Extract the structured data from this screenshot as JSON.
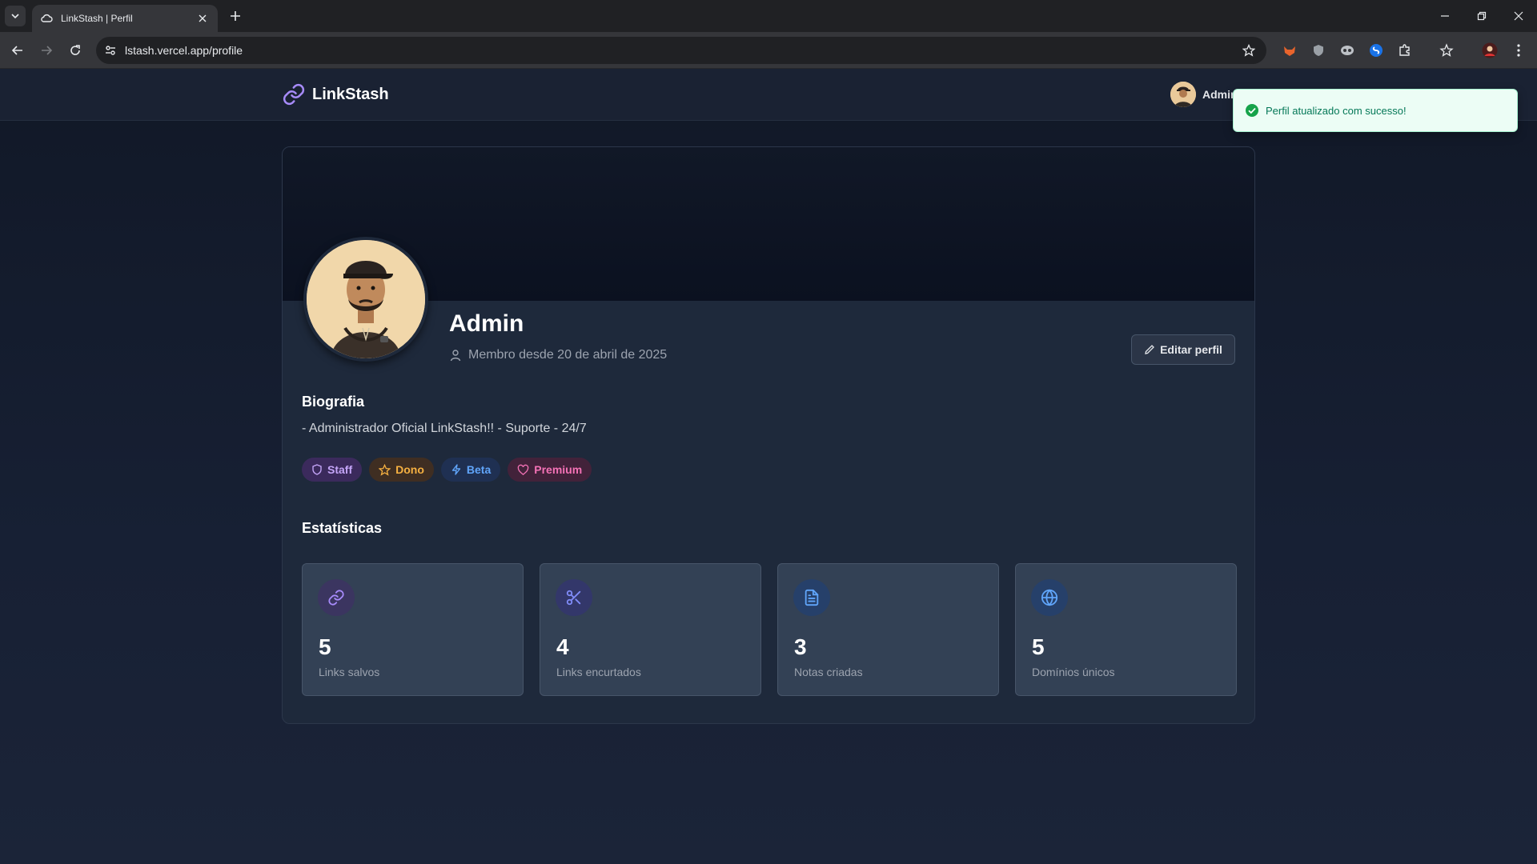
{
  "browser": {
    "tab_title": "LinkStash | Perfil",
    "url": "lstash.vercel.app/profile"
  },
  "app": {
    "brand": "LinkStash",
    "header_user": "Admin"
  },
  "toast": {
    "message": "Perfil atualizado com sucesso!"
  },
  "profile": {
    "name": "Admin",
    "member_since": "Membro desde 20 de abril de 2025",
    "edit_label": "Editar perfil",
    "bio_title": "Biografia",
    "bio_text": "- Administrador Oficial LinkStash!! - Suporte - 24/7",
    "badges": [
      {
        "label": "Staff",
        "icon": "shield-icon",
        "color": "#c4a5f8"
      },
      {
        "label": "Dono",
        "icon": "star-icon",
        "color": "#f5b041"
      },
      {
        "label": "Beta",
        "icon": "lightning-icon",
        "color": "#60a5fa"
      },
      {
        "label": "Premium",
        "icon": "heart-icon",
        "color": "#f472b6"
      }
    ]
  },
  "stats": {
    "title": "Estatísticas",
    "items": [
      {
        "value": "5",
        "label": "Links salvos",
        "icon": "link-icon",
        "color": "#a78bfa"
      },
      {
        "value": "4",
        "label": "Links encurtados",
        "icon": "scissors-icon",
        "color": "#818cf8"
      },
      {
        "value": "3",
        "label": "Notas criadas",
        "icon": "document-icon",
        "color": "#60a5fa"
      },
      {
        "value": "5",
        "label": "Domínios únicos",
        "icon": "globe-icon",
        "color": "#60a5fa"
      }
    ]
  }
}
